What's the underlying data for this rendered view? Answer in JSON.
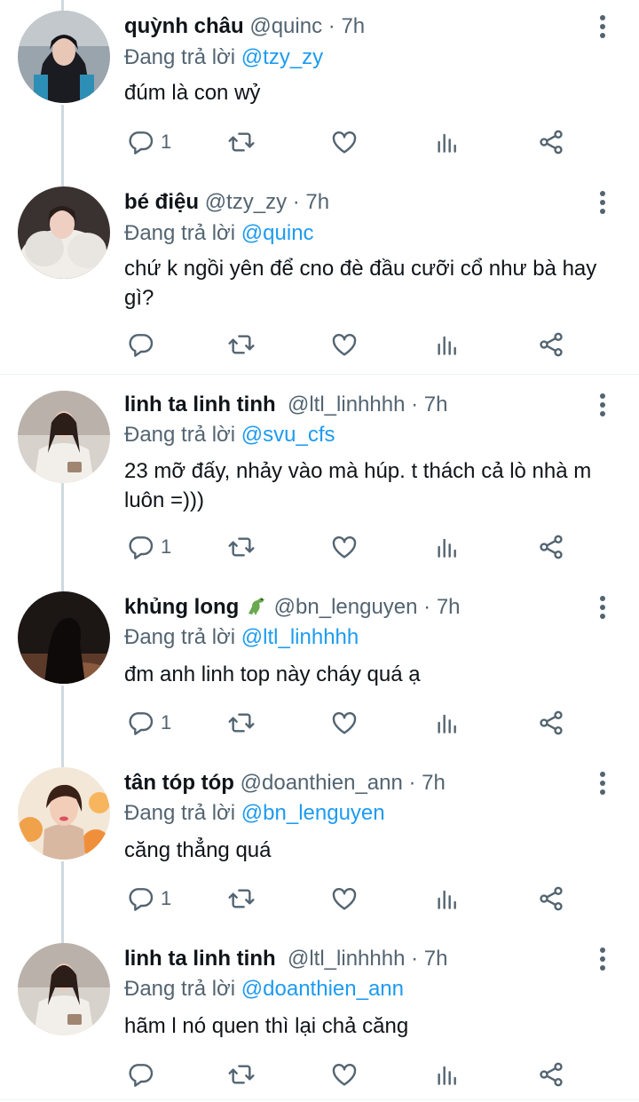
{
  "colors": {
    "name": "#0f1419",
    "secondary": "#536471",
    "link": "#1d9bf0",
    "icon": "#536471",
    "thread_line": "#cfd9de",
    "divider": "#eff3f4"
  },
  "tweets": [
    {
      "name": "quỳnh châu",
      "handle": "@quinc",
      "dot": "·",
      "time": "7h",
      "replying_prefix": "Đang trả lời",
      "replying_to": "@tzy_zy",
      "text": "đúm là con wỷ",
      "reply_count": "1"
    },
    {
      "name": "bé điệu",
      "handle": "@tzy_zy",
      "dot": "·",
      "time": "7h",
      "replying_prefix": "Đang trả lời",
      "replying_to": "@quinc",
      "text": "chứ k ngồi yên để cno đè đầu cưỡi cổ như bà hay gì?",
      "reply_count": ""
    },
    {
      "name": "linh ta linh tinh",
      "handle": "@ltl_linhhhh",
      "dot": "·",
      "time": "7h",
      "replying_prefix": "Đang trả lời",
      "replying_to": "@svu_cfs",
      "text": "23 mỡ đấy, nhảy vào mà húp. t thách cả lò nhà m luôn =)))",
      "reply_count": "1"
    },
    {
      "name": "khủng long",
      "name_icon": "dinosaur-emoji",
      "handle": "@bn_lenguyen",
      "dot": "·",
      "time": "7h",
      "replying_prefix": "Đang trả lời",
      "replying_to": "@ltl_linhhhh",
      "text": "đm anh linh top này cháy quá ạ",
      "reply_count": "1"
    },
    {
      "name": "tân tóp tóp",
      "handle": "@doanthien_ann",
      "dot": "·",
      "time": "7h",
      "replying_prefix": "Đang trả lời",
      "replying_to": "@bn_lenguyen",
      "text": "căng thẳng quá",
      "reply_count": "1"
    },
    {
      "name": "linh ta linh tinh",
      "handle": "@ltl_linhhhh",
      "dot": "·",
      "time": "7h",
      "replying_prefix": "Đang trả lời",
      "replying_to": "@doanthien_ann",
      "text": "hãm l nó quen thì lại chả căng",
      "reply_count": ""
    }
  ],
  "icons": [
    "reply-icon",
    "retweet-icon",
    "like-icon",
    "stats-icon",
    "share-icon",
    "more-options-icon"
  ]
}
